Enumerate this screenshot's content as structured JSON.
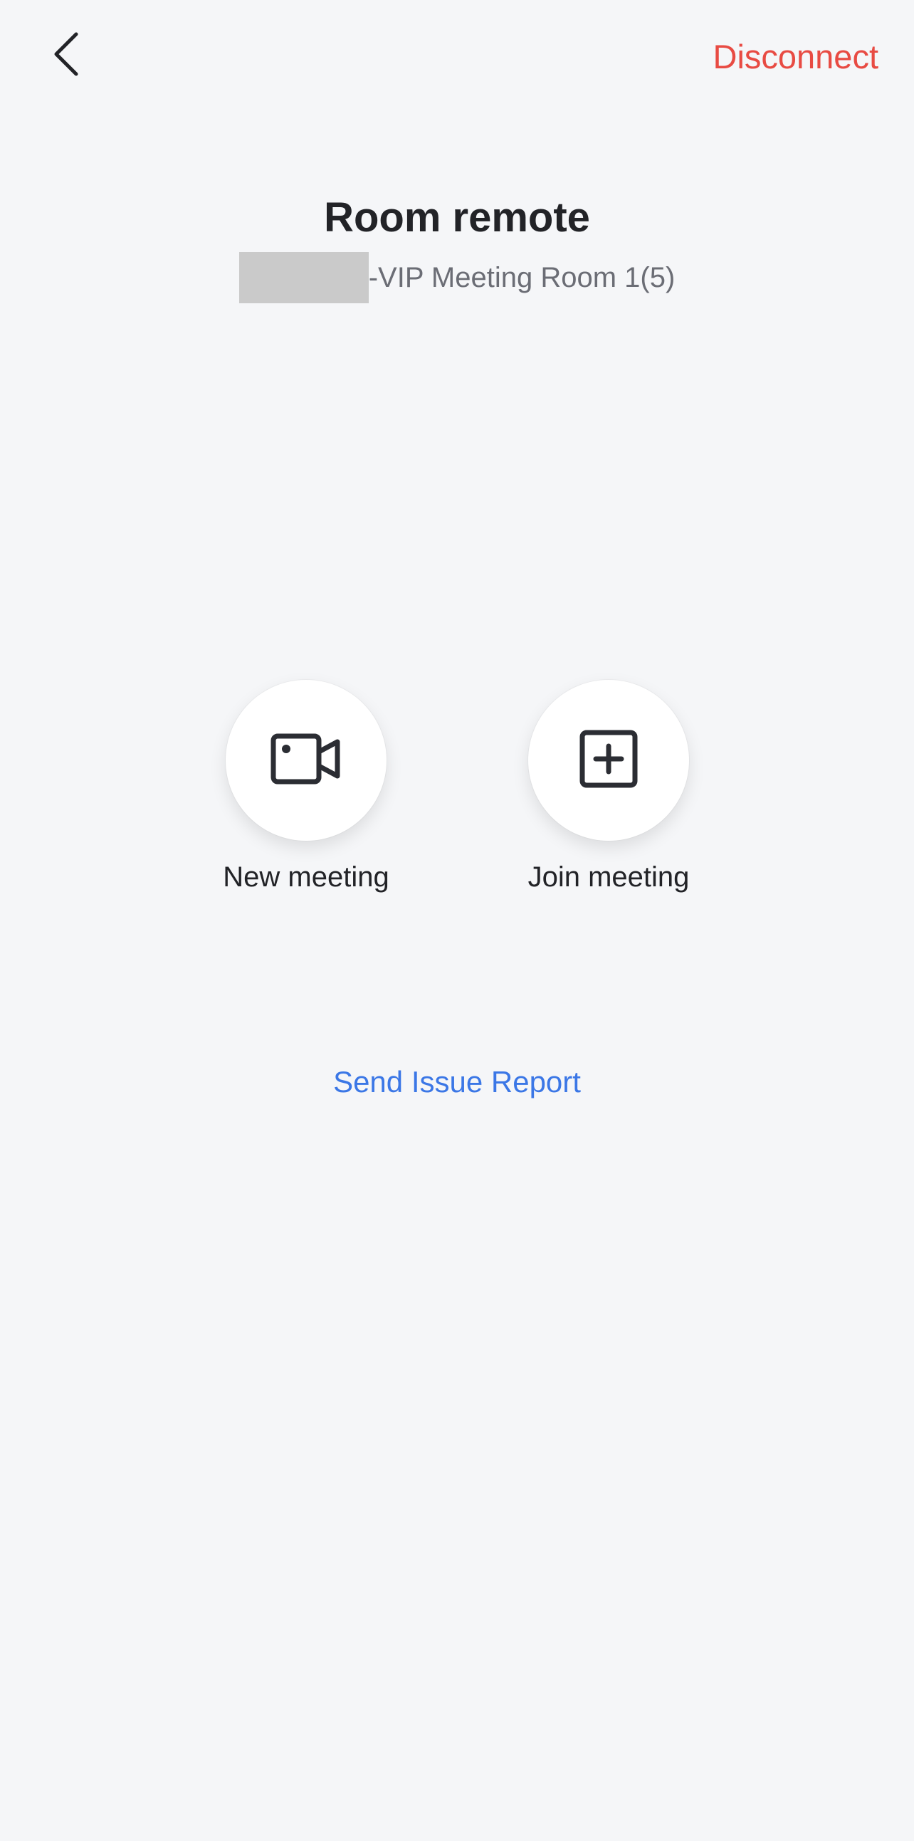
{
  "header": {
    "back_icon": "chevron-left-icon",
    "disconnect_label": "Disconnect",
    "disconnect_color": "#e84b43"
  },
  "main": {
    "title": "Room remote",
    "subtitle_suffix": "-VIP Meeting Room 1(5)"
  },
  "actions": [
    {
      "label": "New meeting",
      "icon": "video-camera-icon"
    },
    {
      "label": "Join meeting",
      "icon": "plus-square-icon"
    }
  ],
  "footer": {
    "report_label": "Send Issue Report",
    "link_color": "#3b77e6"
  }
}
